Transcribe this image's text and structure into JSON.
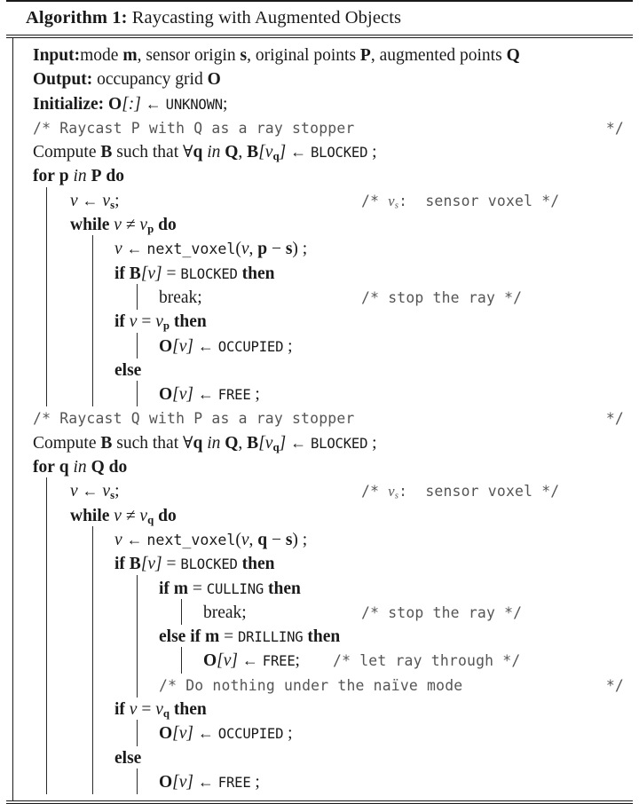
{
  "caption": {
    "label": "Algorithm 1:",
    "title": "Raycasting with Augmented Objects"
  },
  "header": {
    "input_label": "Input:",
    "input_text_1": "mode ",
    "input_var_m": "m",
    "input_text_2": ", sensor origin ",
    "input_var_s": "s",
    "input_text_3": ", original points ",
    "input_var_P": "P",
    "input_text_4": ", augmented points ",
    "input_var_Q": "Q",
    "output_label": "Output:",
    "output_text": "occupancy grid ",
    "output_var_O": "O",
    "init_label": "Initialize:",
    "init_var_O": "O",
    "init_index": "[:]",
    "init_arrow": "←",
    "init_value": "UNKNOWN",
    "init_semi": ";"
  },
  "lines": [
    {
      "id": "comment-raycast-p",
      "kind": "comment-full",
      "open": "/*",
      "text": "Raycast P with Q as a ray stopper",
      "close": "*/"
    },
    {
      "id": "compute-b-p",
      "kind": "stmt",
      "text": "Compute B such that ∀q in Q, B[vq] ← BLOCKED ;"
    },
    {
      "id": "for-p-in-P",
      "kind": "stmt",
      "text": "for p in P do"
    },
    {
      "id": "v-assign-vs-p",
      "kind": "stmt",
      "text": "v ← vₛ;",
      "comment": "/* vₛ:  sensor voxel */"
    },
    {
      "id": "while-v-neq-vp",
      "kind": "stmt",
      "text": "while v ≠ vₚ do"
    },
    {
      "id": "next-voxel-p",
      "kind": "stmt",
      "text": "v ← next_voxel(v, p − s) ;"
    },
    {
      "id": "if-blocked-p",
      "kind": "stmt",
      "text": "if B[v] = BLOCKED then"
    },
    {
      "id": "break-p",
      "kind": "stmt",
      "text": "break;",
      "comment": "/* stop the ray */"
    },
    {
      "id": "if-v-eq-vp",
      "kind": "stmt",
      "text": "if v = vₚ then"
    },
    {
      "id": "set-occupied-p",
      "kind": "stmt",
      "text": "O[v] ← OCCUPIED ;"
    },
    {
      "id": "else-p",
      "kind": "stmt",
      "text": "else"
    },
    {
      "id": "set-free-p",
      "kind": "stmt",
      "text": "O[v] ← FREE ;"
    },
    {
      "id": "comment-raycast-q",
      "kind": "comment-full",
      "open": "/*",
      "text": "Raycast Q with P as a ray stopper",
      "close": "*/"
    },
    {
      "id": "compute-b-q",
      "kind": "stmt",
      "text": "Compute B such that ∀q in Q, B[vq] ← BLOCKED ;"
    },
    {
      "id": "for-q-in-Q",
      "kind": "stmt",
      "text": "for q in Q do"
    },
    {
      "id": "v-assign-vs-q",
      "kind": "stmt",
      "text": "v ← vₛ;",
      "comment": "/* vₛ:  sensor voxel */"
    },
    {
      "id": "while-v-neq-vq",
      "kind": "stmt",
      "text": "while v ≠ vq do"
    },
    {
      "id": "next-voxel-q",
      "kind": "stmt",
      "text": "v ← next_voxel(v, q − s) ;"
    },
    {
      "id": "if-blocked-q",
      "kind": "stmt",
      "text": "if B[v] = BLOCKED then"
    },
    {
      "id": "if-m-culling",
      "kind": "stmt",
      "text": "if m = CULLING then"
    },
    {
      "id": "break-q",
      "kind": "stmt",
      "text": "break;",
      "comment": "/* stop the ray */"
    },
    {
      "id": "else-if-m-drilling",
      "kind": "stmt",
      "text": "else if m = DRILLING then"
    },
    {
      "id": "set-free-drilling",
      "kind": "stmt",
      "text": "O[v] ← FREE;",
      "comment": "/* let ray through */"
    },
    {
      "id": "comment-naive",
      "kind": "comment-full",
      "open": "/*",
      "text": "Do nothing under the naïve mode",
      "close": "*/"
    },
    {
      "id": "if-v-eq-vq",
      "kind": "stmt",
      "text": "if v = vq then"
    },
    {
      "id": "set-occupied-q",
      "kind": "stmt",
      "text": "O[v] ← OCCUPIED ;"
    },
    {
      "id": "else-q",
      "kind": "stmt",
      "text": "else"
    },
    {
      "id": "set-free-q",
      "kind": "stmt",
      "text": "O[v] ← FREE ;"
    }
  ],
  "comments": {
    "raycast_p": "Raycast P with Q as a ray stopper",
    "raycast_q": "Raycast Q with P as a ray stopper",
    "sensor_voxel": "sensor voxel",
    "stop_ray": "stop the ray",
    "let_ray_through": "let ray through",
    "do_nothing_naive": "Do nothing under the naïve mode",
    "open": "/*",
    "close": "*/"
  },
  "keywords": {
    "for": "for",
    "in": "in",
    "do": "do",
    "while": "while",
    "if": "if",
    "then": "then",
    "else": "else",
    "else_if": "else if",
    "break": "break;",
    "compute": "Compute",
    "such_that": "such that"
  },
  "constants": {
    "unknown": "UNKNOWN",
    "blocked": "BLOCKED",
    "occupied": "OCCUPIED",
    "free": "FREE",
    "culling": "CULLING",
    "drilling": "DRILLING",
    "next_voxel": "next_voxel"
  },
  "symbols": {
    "arrow_left": "←",
    "forall": "∀",
    "neq": "≠",
    "eq": "=",
    "minus": "−",
    "semicolon": ";"
  }
}
